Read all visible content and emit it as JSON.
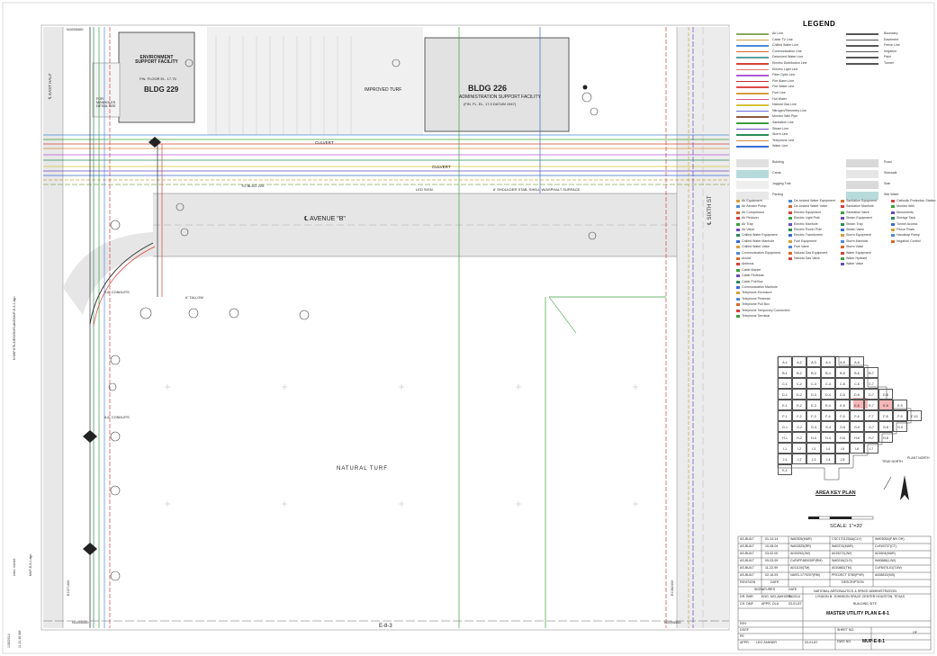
{
  "legend": {
    "title": "LEGEND",
    "lines_left": [
      {
        "label": "Air Line",
        "color": "#8aa85a"
      },
      {
        "label": "Cable TV Line",
        "color": "#c8a04a"
      },
      {
        "label": "Chilled Water Line",
        "color": "#4a8ad6"
      },
      {
        "label": "Communication Line",
        "color": "#d86a2a"
      },
      {
        "label": "Deionized Water Line",
        "color": "#5aa0a0"
      },
      {
        "label": "Electric Distribution Line",
        "color": "#d6403a"
      },
      {
        "label": "Electric Light Line",
        "color": "#e07a7a"
      },
      {
        "label": "Fiber Optic Line",
        "color": "#b05ad6"
      },
      {
        "label": "Fire Alarm Line",
        "color": "#c03030"
      },
      {
        "label": "Fire Water Line",
        "color": "#e04a4a"
      },
      {
        "label": "Fuel Line",
        "color": "#d6a03a"
      },
      {
        "label": "Hot Water",
        "color": "#d65a8a"
      },
      {
        "label": "Natural Gas Line",
        "color": "#d6c03a"
      },
      {
        "label": "Nitrogen/Telemetry Line",
        "color": "#6a6ad6"
      },
      {
        "label": "Monitor Well Pipe",
        "color": "#8a5a3a"
      },
      {
        "label": "Sanitation Line",
        "color": "#3aa03a"
      },
      {
        "label": "Steam Line",
        "color": "#6a4ac0"
      },
      {
        "label": "Storm Line",
        "color": "#2a8a5a"
      },
      {
        "label": "Telephone Line",
        "color": "#d68a3a"
      },
      {
        "label": "Water Line",
        "color": "#3a6ad6"
      }
    ],
    "lines_right": [
      "Boundary",
      "Easement",
      "Fence Line",
      "Irrigation",
      "Paint",
      "Tunnel"
    ],
    "areas_left": [
      "Building",
      "Canal",
      "Jogging Trail",
      "Parking"
    ],
    "areas_right": [
      "Road",
      "Sidewalk",
      "Slab",
      "Site Water"
    ],
    "symbols_col1": [
      "Air Equipment",
      "Air Aerator Pump",
      "Air Compressor",
      "Air Reducer",
      "Air Trap",
      "Air Valve",
      "Chilled Water Equipment",
      "Chilled Water Manhole",
      "Chilled Water Valve",
      "Communication Equipment",
      "Anode",
      "Antenna",
      "Cable Marker",
      "Cable Pedestal",
      "Cable Pull Box",
      "Communication Manhole",
      "Telephone Enclosure",
      "Telephone Pedestal",
      "Telephone Pull Box",
      "Telephone Temporary Connection",
      "Telephone Terminal"
    ],
    "symbols_col2": [
      "De-ionized Water Equipment",
      "De-ionized Water Valve",
      "Electric Equipment",
      "Electric Light Pole",
      "Electric Manhole",
      "Electric Power Pole",
      "Electric Transformer",
      "Fuel Equipment",
      "Fuel Valve",
      "Natural Gas Equipment",
      "Natural Gas Valve"
    ],
    "symbols_col3": [
      "Sanitation Equipment",
      "Sanitation Manhole",
      "Sanitation Valve",
      "Steam Equipment",
      "Steam Trap",
      "Steam Valve",
      "Storm Equipment",
      "Storm Manhole",
      "Storm Valve",
      "Water Equipment",
      "Water Hydrant",
      "Water Valve"
    ],
    "symbols_col4": [
      "Cathodic Protection Station",
      "Monitor Well",
      "Monuments",
      "Storage Tank",
      "Tunnel Access",
      "Fence Posts",
      "Handicap Ramp",
      "Irrigation Control"
    ]
  },
  "key_plan": {
    "title": "AREA KEY PLAN",
    "rows": [
      [
        "A-1",
        "A-2",
        "A-3",
        "A-4",
        "A-5",
        "A-6"
      ],
      [
        "B-1",
        "B-2",
        "B-3",
        "B-4",
        "B-5",
        "B-6",
        "B-7"
      ],
      [
        "C-1",
        "C-2",
        "C-3",
        "C-4",
        "C-5",
        "C-6",
        "C-7"
      ],
      [
        "D-1",
        "D-2",
        "D-3",
        "D-4",
        "D-5",
        "D-6",
        "D-7",
        "D-8"
      ],
      [
        "E-1",
        "E-2",
        "E-3",
        "E-4",
        "E-5",
        "E-6",
        "E-7",
        "E-8",
        "E-9"
      ],
      [
        "F-1",
        "F-2",
        "F-3",
        "F-4",
        "F-5",
        "F-6",
        "F-7",
        "F-8",
        "F-9",
        "F-10"
      ],
      [
        "G-1",
        "G-2",
        "G-3",
        "G-4",
        "G-5",
        "G-6",
        "G-7",
        "G-8",
        "G-9"
      ],
      [
        "H-1",
        "H-2",
        "H-3",
        "H-4",
        "H-5",
        "H-6",
        "H-7",
        "H-8"
      ],
      [
        "I-1",
        "I-2",
        "I-3",
        "I-4",
        "I-5",
        "I-6",
        "I-7"
      ],
      [
        "J-1",
        "J-2",
        "J-3",
        "J-4",
        "J-5"
      ],
      [
        "K-1"
      ]
    ],
    "highlight": "E-8",
    "north_label": "TRUE NORTH",
    "plant_north": "PLANT NORTH"
  },
  "scale": {
    "label": "SCALE: 1\"=20'"
  },
  "revisions": [
    {
      "rev": "AS-BUILT",
      "date": "01-14-14",
      "c1": "W#0305(MAR)",
      "c2": "CSC1701254A(CLY)",
      "c3": "W#0305A(F.NN OH)"
    },
    {
      "rev": "AS-BUILT",
      "date": "10-08-04",
      "c1": "W#02825(RR)",
      "c2": "W#0374(MAR)",
      "c3": "CoF#0707(CT)"
    },
    {
      "rev": "AS-BUILT",
      "date": "03-02-00",
      "c1": "A015252(JW)",
      "c2": "A015272(JW)",
      "c3": "A01604(MAR)"
    },
    {
      "rev": "AS-BUILT",
      "date": "09-03-99",
      "c1": "CoF#FF480030P(RM)",
      "c2": "W#0216(CLS)",
      "c3": "W#0688(LJW)"
    },
    {
      "rev": "AS-BUILT",
      "date": "11-22-99",
      "c1": "A011100(TM)",
      "c2": "A010882(TM)",
      "c3": "CoF8476-01(TJW)"
    },
    {
      "rev": "AS-BUILT",
      "date": "02-16-93",
      "c1": "NASS-1779207(RM)",
      "c2": "PROJECT S780(PVR)",
      "c3": "A008810(MS)"
    }
  ],
  "revision_headers": {
    "rev": "REVISION",
    "date": "DATE",
    "desc": "DESCRIPTION"
  },
  "signatures": {
    "heading": "SIGNATURES",
    "date_heading": "DATE",
    "dr": "DR. BHR",
    "eng": "ENG. MCLAWHORN",
    "date1": "01/2014",
    "ch": "CH. DMF",
    "appr": "APPR. OLA",
    "date2": "03-01-87"
  },
  "agency": {
    "line1": "NATIONAL AERONAUTICS & SPACE ADMINISTRATION",
    "line2": "LYNDON B. JOHNSON SPACE CENTER  HOUSTON, TEXAS",
    "line3": "BUILDING SITE"
  },
  "sheet_title": "MASTER UTILITY PLAN E-8-1",
  "dwg_no": "MUP-E-8-1",
  "title_block_labels": {
    "rev": "REV",
    "dsgf": "DSGF",
    "pe": "PE",
    "appr": "APPR.",
    "appr_name": "LEO ZAHNER",
    "sheet_no": "SHEET NO.",
    "dwg_no_label": "DWG NO.",
    "of": "OF",
    "date_appr": "03-01-87"
  },
  "plan_labels": {
    "bldg229_name": "ENVIRONMENT SUPPORT FACILITY",
    "bldg229_num": "BLDG 229",
    "bldg229_floor": "FIN. FLOOR EL. 17.75",
    "bldg226_num": "BLDG 226",
    "bldg226_name": "ADMINISTRATION SUPPORT FACILITY",
    "bldg226_floor": "(FIN. FL. EL. 17.0 DATUM 1947)",
    "improved_turf": "IMPROVED TURF",
    "avenue_b": "℄ AVENUE \"B\"",
    "sixth_st": "℄ SIXTH ST",
    "natural_turf": "NATURAL TURF",
    "culvert1": "CULVERT",
    "culvert2": "CULVERT",
    "shoulder": "6' SHOULDER STAB. SHELL W/ASPHALT SURFACE",
    "to_bldg": "TO BLDG 229",
    "led_sign": "LED SIGN",
    "sheet_bottom": "E-8-3",
    "coord_bl": "N1055400",
    "coord_br": "N1055400",
    "coord_tl": "N1055400",
    "east_half": "℄ EAST HALF",
    "natural_turf_label2": "6\" TALLOW",
    "conduits1": "4-6\" CONDUITS",
    "conduits2": "6-6\" CONDUITS",
    "for_manholes": "FOR MANHOLES DETAIL SEE",
    "e1071": "E1071400",
    "e1082": "E1082400",
    "side_path": "N:\\MIPUTIL\\DESIGN\\PLANS\\MUP-E-8-1.dgn",
    "side_user": "User: bselz2",
    "side_date": "1/30/2014",
    "side_time": "11:21:46 AM",
    "side_file": "MUP-E-8-1.dgn"
  }
}
